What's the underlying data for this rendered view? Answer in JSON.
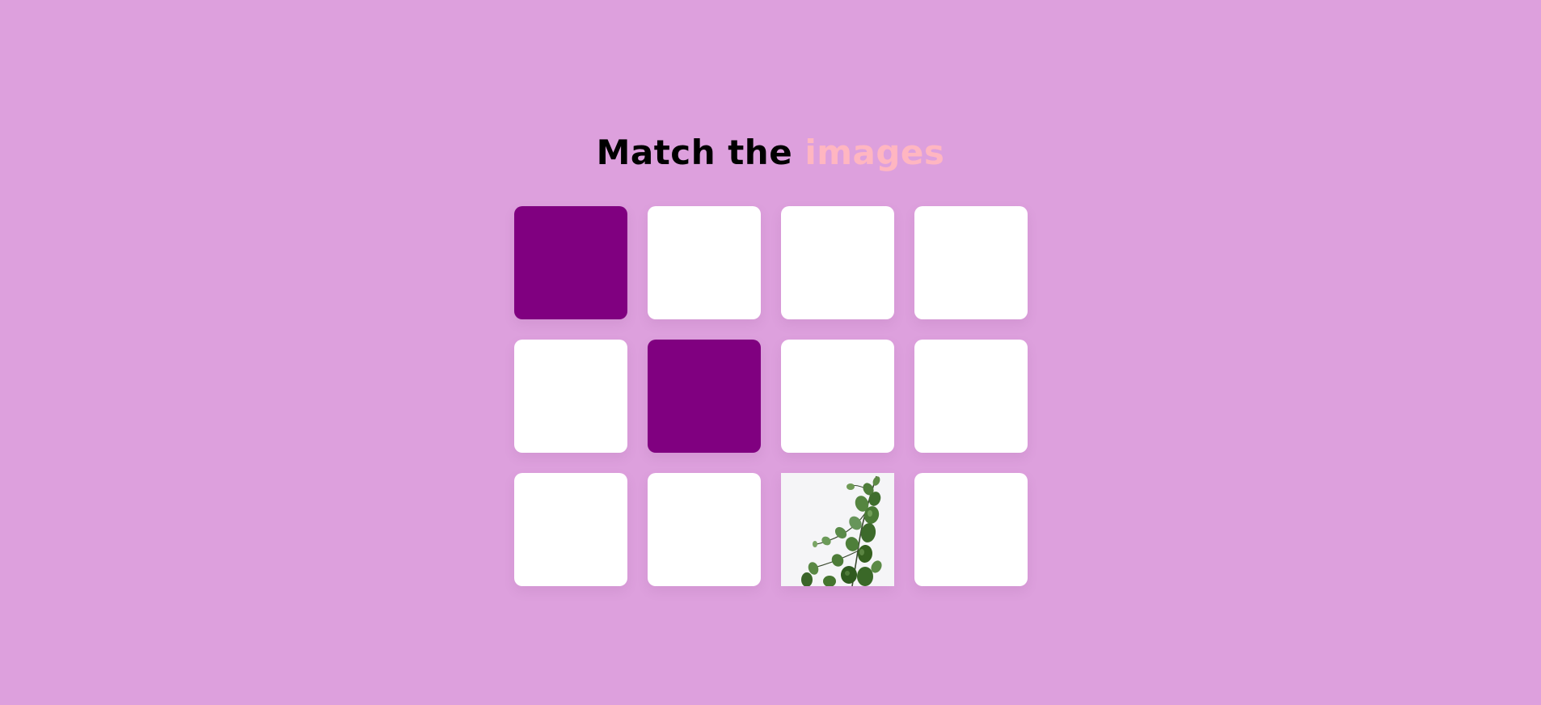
{
  "title": {
    "part1": "Match the",
    "part2": "images"
  },
  "colors": {
    "background": "#DDA0DD",
    "card_face_down": "#FFFFFF",
    "card_selected": "#800080",
    "title_accent": "#FFB6C1"
  },
  "cards": [
    {
      "row": 1,
      "col": 1,
      "state": "selected"
    },
    {
      "row": 1,
      "col": 2,
      "state": "face-down"
    },
    {
      "row": 1,
      "col": 3,
      "state": "face-down"
    },
    {
      "row": 1,
      "col": 4,
      "state": "face-down"
    },
    {
      "row": 2,
      "col": 1,
      "state": "face-down"
    },
    {
      "row": 2,
      "col": 2,
      "state": "selected"
    },
    {
      "row": 2,
      "col": 3,
      "state": "face-down"
    },
    {
      "row": 2,
      "col": 4,
      "state": "face-down"
    },
    {
      "row": 3,
      "col": 1,
      "state": "face-down"
    },
    {
      "row": 3,
      "col": 2,
      "state": "face-down"
    },
    {
      "row": 3,
      "col": 3,
      "state": "revealed",
      "image": "eucalyptus-plant-image"
    },
    {
      "row": 3,
      "col": 4,
      "state": "face-down"
    }
  ]
}
